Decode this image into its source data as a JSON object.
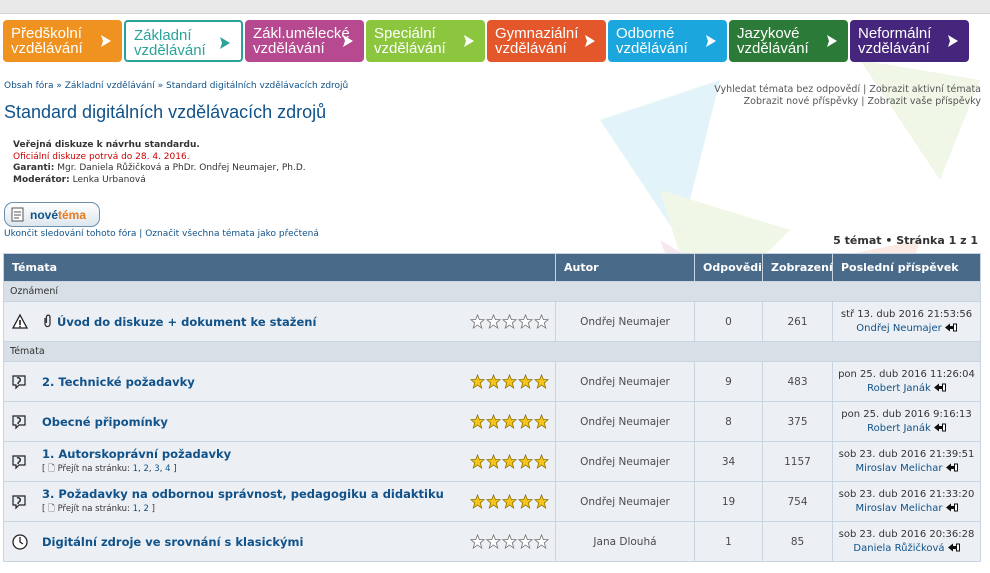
{
  "tabs": [
    {
      "line1": "Předškolní",
      "line2": "vzdělávání",
      "color": "#f0921f"
    },
    {
      "line1": "Základní",
      "line2": "vzdělávání",
      "color": "#2ba29a",
      "active": true
    },
    {
      "line1": "Zákl.umělecké",
      "line2": "vzdělávání",
      "color": "#b6498f"
    },
    {
      "line1": "Speciální",
      "line2": "vzdělávání",
      "color": "#8cc63e"
    },
    {
      "line1": "Gymnaziální",
      "line2": "vzdělávání",
      "color": "#e4572a"
    },
    {
      "line1": "Odborné",
      "line2": "vzdělávání",
      "color": "#1ca6de"
    },
    {
      "line1": "Jazykové",
      "line2": "vzdělávání",
      "color": "#2c7a38"
    },
    {
      "line1": "Neformální",
      "line2": "vzdělávání",
      "color": "#46257c"
    }
  ],
  "breadcrumb": [
    "Obsah fóra",
    "Základní vzdělávání",
    "Standard digitálních vzdělávacích zdrojů"
  ],
  "quicklinks": {
    "line1a": "Vyhledat témata bez odpovědí",
    "line1b": "Zobrazit aktivní témata",
    "line2a": "Zobrazit nové příspěvky",
    "line2b": "Zobrazit vaše příspěvky"
  },
  "title": "Standard digitálních vzdělávacích zdrojů",
  "info": {
    "line1": "Veřejná diskuze k návrhu standardu.",
    "line2": "Oficiální diskuze potrvá do 28. 4. 2016.",
    "guarantors_label": "Garanti:",
    "guarantors": "Mgr. Daniela Růžičková a PhDr. Ondřej Neumajer, Ph.D.",
    "moderator_label": "Moderátor:",
    "moderator": "Lenka Urbanová"
  },
  "newtopic": {
    "part1": "nové",
    "part2": "téma"
  },
  "forumlinks": {
    "unsubscribe": "Ukončit sledování tohoto fóra",
    "mark_read": "Označit všechna témata jako přečtená"
  },
  "pagination": "5 témat • Stránka 1 z 1",
  "table": {
    "headers": {
      "topics": "Témata",
      "author": "Autor",
      "replies": "Odpovědi",
      "views": "Zobrazení",
      "last": "Poslední příspěvek"
    },
    "announcements_label": "Oznámení",
    "topics_label": "Témata",
    "announcement": {
      "title": "Úvod do diskuze + dokument ke stažení",
      "author": "Ondřej Neumajer",
      "replies": "0",
      "views": "261",
      "last_date": "stř 13. dub 2016 21:53:56",
      "last_user": "Ondřej Neumajer",
      "rating": 0
    },
    "topics": [
      {
        "title": "2. Technické požadavky",
        "author": "Ondřej Neumajer",
        "replies": "9",
        "views": "483",
        "last_date": "pon 25. dub 2016 11:26:04",
        "last_user": "Robert Janák",
        "rating": 5,
        "pages": []
      },
      {
        "title": "Obecné připomínky",
        "author": "Ondřej Neumajer",
        "replies": "8",
        "views": "375",
        "last_date": "pon 25. dub 2016 9:16:13",
        "last_user": "Robert Janák",
        "rating": 5,
        "pages": []
      },
      {
        "title": "1. Autorskoprávní požadavky",
        "author": "Ondřej Neumajer",
        "replies": "34",
        "views": "1157",
        "last_date": "sob 23. dub 2016 21:39:51",
        "last_user": "Miroslav Melichar",
        "rating": 5,
        "pages_label": "Přejít na stránku:",
        "pages": [
          "1",
          "2",
          "3",
          "4"
        ]
      },
      {
        "title": "3. Požadavky na odbornou správnost, pedagogiku a didaktiku",
        "author": "Ondřej Neumajer",
        "replies": "19",
        "views": "754",
        "last_date": "sob 23. dub 2016 21:33:20",
        "last_user": "Miroslav Melichar",
        "rating": 5,
        "pages_label": "Přejít na stránku:",
        "pages": [
          "1",
          "2"
        ]
      },
      {
        "title": "Digitální zdroje ve srovnání s klasickými",
        "author": "Jana Dlouhá",
        "replies": "1",
        "views": "85",
        "last_date": "sob 23. dub 2016 20:36:28",
        "last_user": "Daniela Růžičková",
        "rating": 0,
        "pages": []
      }
    ]
  }
}
